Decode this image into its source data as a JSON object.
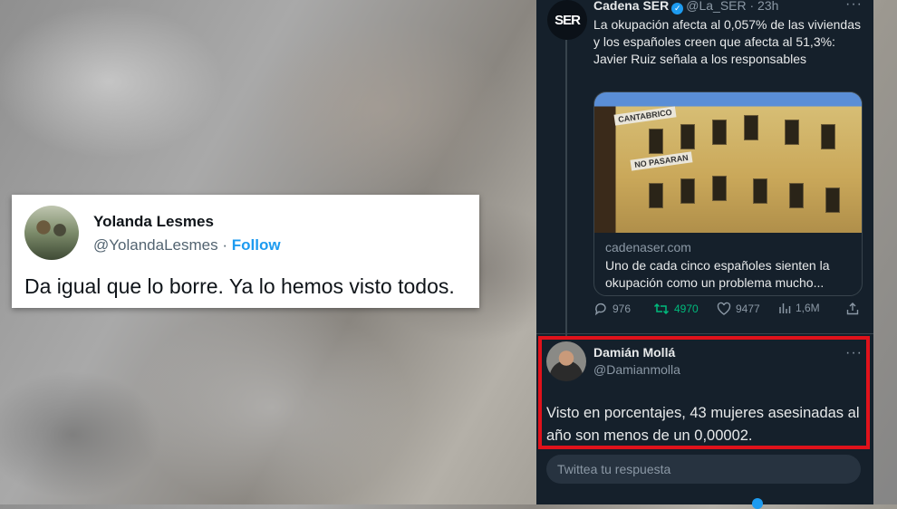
{
  "left_tweet": {
    "name": "Yolanda Lesmes",
    "handle": "@YolandaLesmes",
    "separator": "·",
    "follow_label": "Follow",
    "text": "Da igual que lo borre. Ya lo hemos visto todos."
  },
  "ser_tweet": {
    "avatar_text": "SER",
    "name": "Cadena SER",
    "handle": "@La_SER",
    "time": "· 23h",
    "more": "···",
    "text": "La okupación afecta al 0,057% de las viviendas y los españoles creen que afecta al 51,3%: Javier Ruiz señala a los responsables",
    "photo_banners": [
      "CANTABRICO",
      "NO PASARAN"
    ],
    "link_domain": "cadenaser.com",
    "link_title": "Uno de cada cinco españoles sienten la okupación como un problema mucho...",
    "actions": {
      "replies": "976",
      "retweets": "4970",
      "likes": "9477",
      "views": "1,6M"
    }
  },
  "reply_tweet": {
    "name": "Damián Mollá",
    "handle": "@Damianmolla",
    "more": "···",
    "text": "Visto en porcentajes, 43 mujeres asesinadas al año son menos de un 0,00002."
  },
  "reply_input": {
    "placeholder": "Twittea tu respuesta"
  },
  "colors": {
    "panel_bg": "#15202b",
    "accent": "#1d9bf0",
    "retweet_green": "#00ba7c",
    "highlight_red": "#e0121b"
  }
}
